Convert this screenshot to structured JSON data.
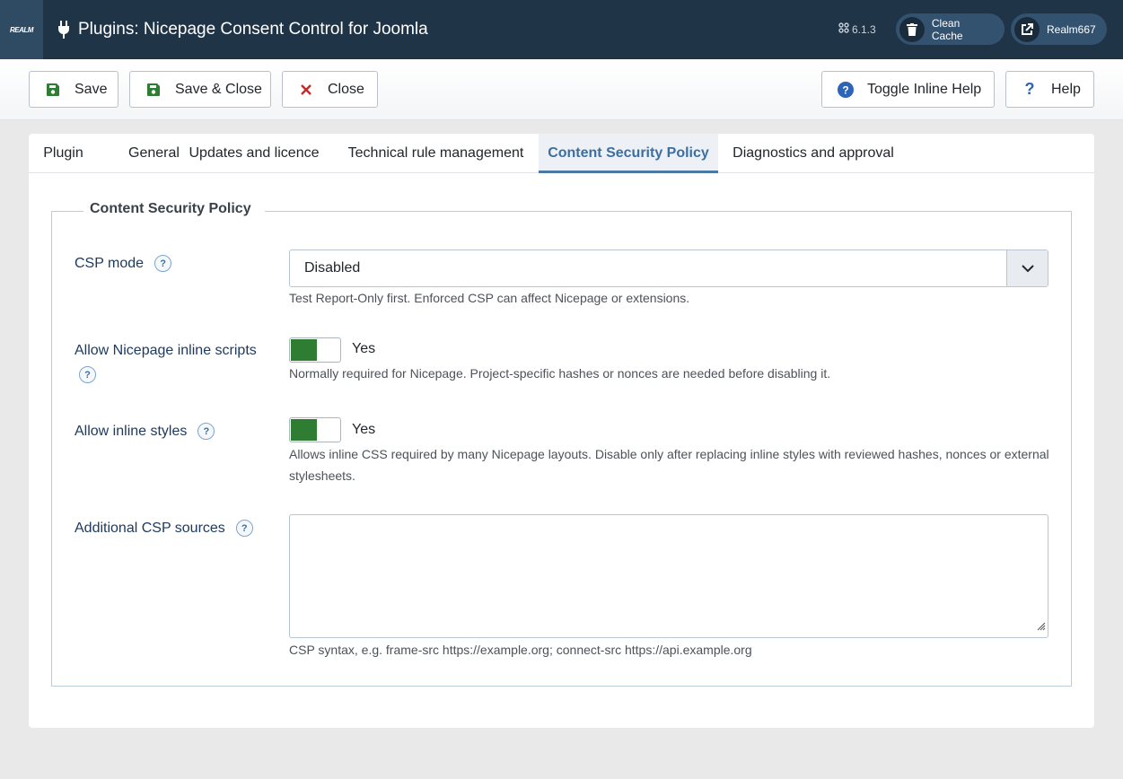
{
  "header": {
    "logo_text": "REALM",
    "title": "Plugins: Nicepage Consent Control for Joomla",
    "version": "6.1.3",
    "clean_cache_label": "Clean Cache",
    "user_label": "Realm667",
    "icons": [
      "plug-icon",
      "joomla-icon",
      "trash-icon",
      "external-link-icon"
    ]
  },
  "toolbar": {
    "save_label": "Save",
    "save_close_label": "Save & Close",
    "close_label": "Close",
    "toggle_help_label": "Toggle Inline Help",
    "help_label": "Help",
    "colors": {
      "save_icon": "#2e7d32",
      "close_icon": "#c52827",
      "help_icon": "#2c64b8"
    }
  },
  "tabs": [
    {
      "label": "Plugin"
    },
    {
      "label": "General"
    },
    {
      "label": "Updates and licence"
    },
    {
      "label": "Technical rule management"
    },
    {
      "label": "Content Security Policy",
      "active": true
    },
    {
      "label": "Diagnostics and approval"
    }
  ],
  "fieldset": {
    "legend": "Content Security Policy",
    "csp_mode": {
      "label": "CSP mode",
      "value": "Disabled",
      "hint": "Test Report-Only first. Enforced CSP can affect Nicepage or extensions."
    },
    "inline_scripts": {
      "label": "Allow Nicepage inline scripts",
      "value": "Yes",
      "enabled": true,
      "hint": "Normally required for Nicepage. Project-specific hashes or nonces are needed before disabling it."
    },
    "inline_styles": {
      "label": "Allow inline styles",
      "value": "Yes",
      "enabled": true,
      "hint_line1": "Allows inline CSS required by many Nicepage layouts. Disable only after replacing inline styles with reviewed hashes, nonces or external",
      "hint_line2": "stylesheets."
    },
    "additional_sources": {
      "label": "Additional CSP sources",
      "value": "",
      "hint": "CSP syntax, e.g. frame-src https://example.org; connect-src https://api.example.org"
    }
  },
  "colors": {
    "header_bg": "#1f3447",
    "accent": "#3d6ea0",
    "switch_on": "#2e7d32"
  }
}
